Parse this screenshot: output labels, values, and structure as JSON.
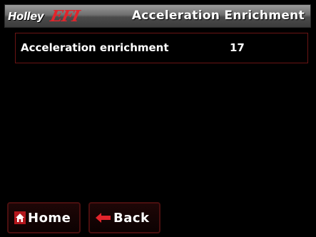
{
  "header": {
    "logo_brand": "Holley",
    "logo_product": "EFI",
    "title": "Acceleration Enrichment"
  },
  "parameter": {
    "label": "Acceleration enrichment",
    "value": "17"
  },
  "buttons": {
    "home_label": "Home",
    "back_label": "Back"
  },
  "colors": {
    "accent_red": "#e2242b",
    "border_dark_red": "#6a1414",
    "background": "#000000",
    "text": "#ffffff"
  },
  "icons": {
    "home": "home-icon",
    "back": "left-arrow-icon"
  }
}
